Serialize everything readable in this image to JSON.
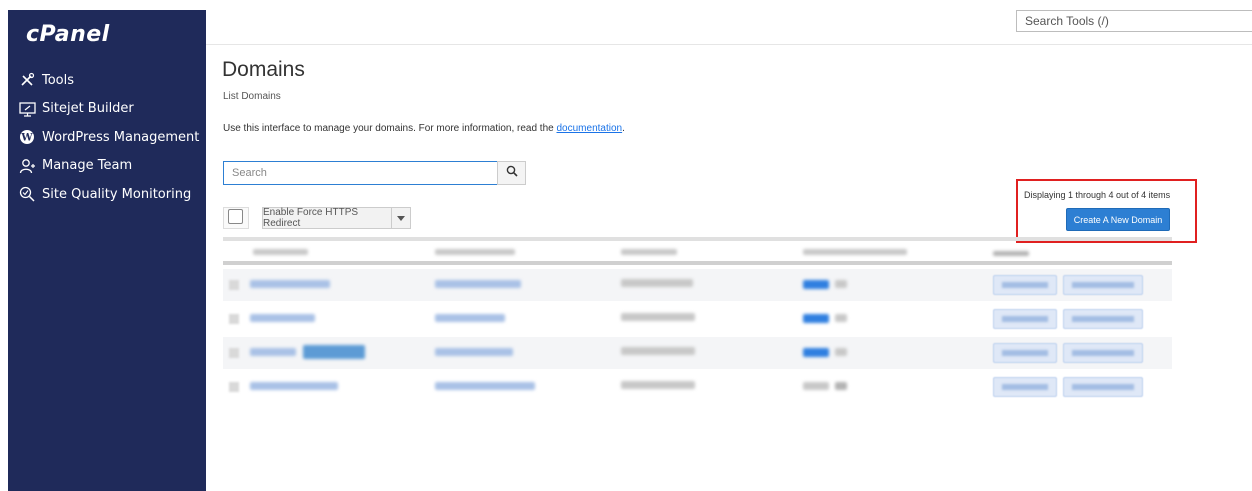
{
  "brand": {
    "logo_text": "cPanel"
  },
  "sidebar": {
    "items": [
      {
        "label": "Tools",
        "icon": "tools-icon"
      },
      {
        "label": "Sitejet Builder",
        "icon": "sitejet-icon"
      },
      {
        "label": "WordPress Management",
        "icon": "wordpress-icon"
      },
      {
        "label": "Manage Team",
        "icon": "team-icon"
      },
      {
        "label": "Site Quality Monitoring",
        "icon": "site-quality-icon"
      }
    ]
  },
  "header": {
    "search_placeholder": "Search Tools (/)"
  },
  "page": {
    "title": "Domains",
    "subtitle": "List Domains",
    "description": "Use this interface to manage your domains. For more information, read the ",
    "doc_link": "documentation",
    "desc_suffix": "."
  },
  "search": {
    "placeholder": "Search"
  },
  "toolbar": {
    "force_https_label": "Enable Force HTTPS Redirect",
    "display_text": "Displaying 1 through 4 out of 4 items",
    "create_label": "Create A New Domain"
  },
  "colors": {
    "sidebar_bg": "#1f2a5a",
    "accent": "#2d7fd3",
    "highlight_border": "#e02020"
  }
}
